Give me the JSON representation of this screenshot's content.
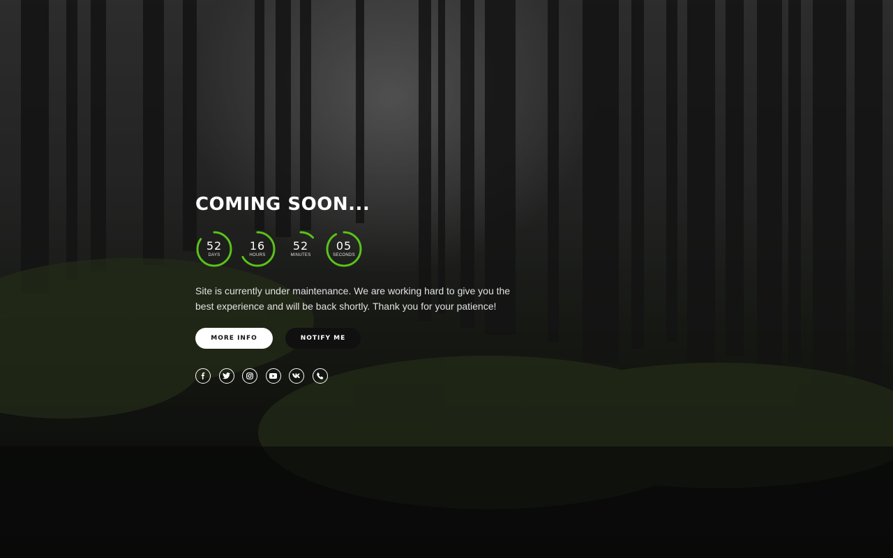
{
  "page": {
    "title": "COMING SOON...",
    "description": "Site is currently under maintenance. We are working hard to give you the best experience and will be back shortly. Thank you for your patience!"
  },
  "countdown": [
    {
      "value": "52",
      "unit": "DAYS",
      "progress": 0.85
    },
    {
      "value": "16",
      "unit": "HOURS",
      "progress": 0.67
    },
    {
      "value": "52",
      "unit": "MINUTES",
      "progress": 0.13
    },
    {
      "value": "05",
      "unit": "SECONDS",
      "progress": 0.92
    }
  ],
  "buttons": {
    "more_info": "MORE INFO",
    "notify_me": "NOTIFY ME"
  },
  "socials": [
    {
      "name": "facebook-icon",
      "glyph": "f"
    },
    {
      "name": "twitter-icon",
      "glyph": "t"
    },
    {
      "name": "instagram-icon",
      "glyph": "ig"
    },
    {
      "name": "youtube-icon",
      "glyph": "yt"
    },
    {
      "name": "vk-icon",
      "glyph": "vk"
    },
    {
      "name": "phone-icon",
      "glyph": "ph"
    }
  ],
  "colors": {
    "accent": "#5ac318",
    "ring_track": "#3a3a3a",
    "text": "#ffffff"
  }
}
